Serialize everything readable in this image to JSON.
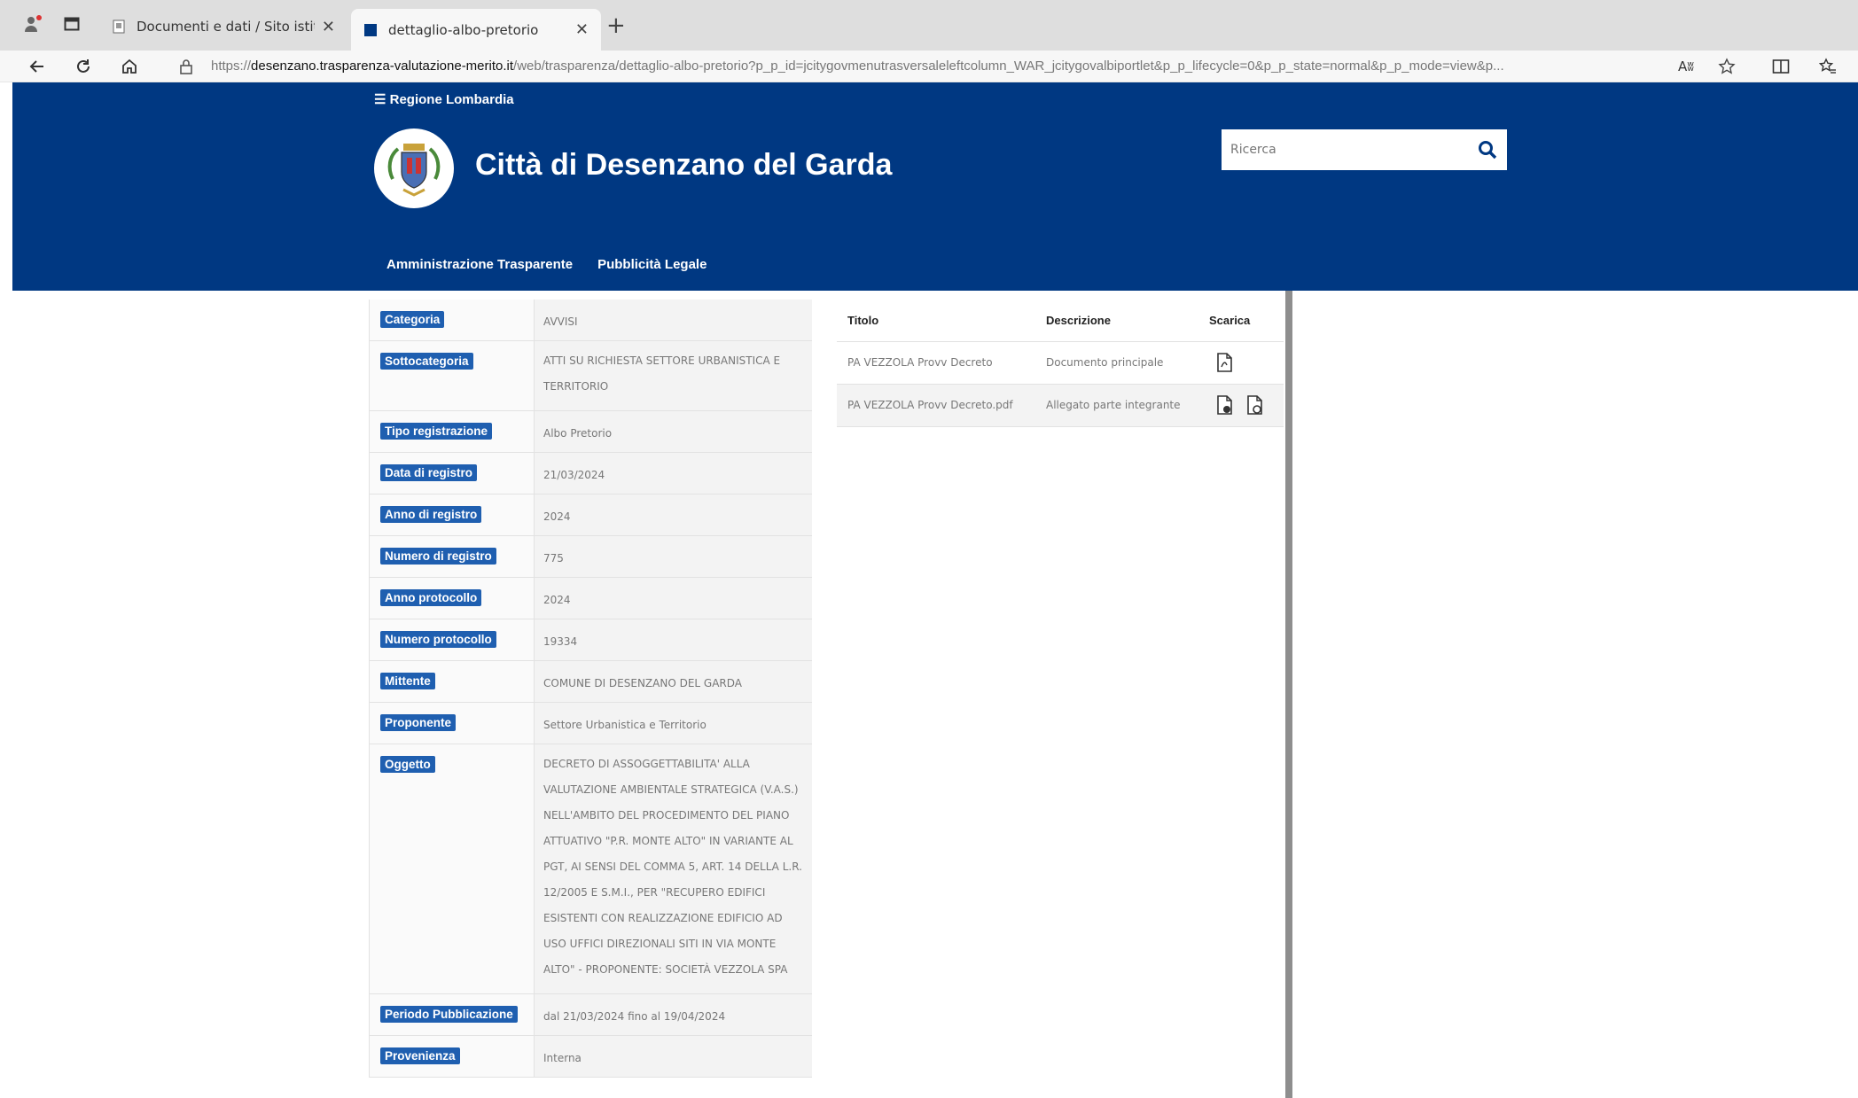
{
  "browser": {
    "tabs": [
      {
        "label": "Documenti e dati / Sito istituzio",
        "active": false
      },
      {
        "label": "dettaglio-albo-pretorio",
        "active": true
      }
    ],
    "new_tab_label": "+",
    "url_prefix": "https://",
    "url_host": "desenzano.trasparenza-valutazione-merito.it",
    "url_path": "/web/trasparenza/dettaglio-albo-pretorio?p_p_id=jcitygovmenutrasversaleleftcolumn_WAR_jcitygovalbiportlet&p_p_lifecycle=0&p_p_state=normal&p_p_mode=view&p...",
    "read_aloud_label": "Aʬ"
  },
  "header": {
    "region": "Regione Lombardia",
    "title": "Città di Desenzano del Garda",
    "search_placeholder": "Ricerca",
    "menu": [
      "Amministrazione Trasparente",
      "Pubblicità Legale"
    ]
  },
  "detail": {
    "rows": [
      {
        "label": "Categoria",
        "value": "AVVISI"
      },
      {
        "label": "Sottocategoria",
        "value": "ATTI SU RICHIESTA SETTORE URBANISTICA E TERRITORIO"
      },
      {
        "label": "Tipo registrazione",
        "value": "Albo Pretorio"
      },
      {
        "label": "Data di registro",
        "value": "21/03/2024"
      },
      {
        "label": "Anno di registro",
        "value": "2024"
      },
      {
        "label": "Numero di registro",
        "value": "775"
      },
      {
        "label": "Anno protocollo",
        "value": "2024"
      },
      {
        "label": "Numero protocollo",
        "value": "19334"
      },
      {
        "label": "Mittente",
        "value": "COMUNE DI DESENZANO DEL GARDA"
      },
      {
        "label": "Proponente",
        "value": "Settore Urbanistica e Territorio"
      },
      {
        "label": "Oggetto",
        "value": "DECRETO DI ASSOGGETTABILITA' ALLA VALUTAZIONE AMBIENTALE STRATEGICA (V.A.S.) NELL'AMBITO DEL PROCEDIMENTO DEL PIANO ATTUATIVO \"P.R. MONTE ALTO\" IN VARIANTE AL PGT, AI SENSI DEL COMMA 5, ART. 14 DELLA L.R. 12/2005 E S.M.I., PER \"RECUPERO EDIFICI ESISTENTI CON REALIZZAZIONE EDIFICIO AD USO UFFICI DIREZIONALI SITI IN VIA MONTE ALTO\" - PROPONENTE: SOCIETÀ VEZZOLA SPA"
      },
      {
        "label": "Periodo Pubblicazione",
        "value": "dal 21/03/2024 fino al 19/04/2024"
      },
      {
        "label": "Provenienza",
        "value": "Interna"
      }
    ]
  },
  "attachments": {
    "headers": {
      "title": "Titolo",
      "description": "Descrizione",
      "download": "Scarica"
    },
    "rows": [
      {
        "title": "PA VEZZOLA Provv Decreto",
        "description": "Documento principale"
      },
      {
        "title": "PA VEZZOLA Provv Decreto.pdf",
        "description": "Allegato parte integrante"
      }
    ]
  },
  "colors": {
    "header_bg": "#003882",
    "badge_bg": "#1f5fb0"
  }
}
